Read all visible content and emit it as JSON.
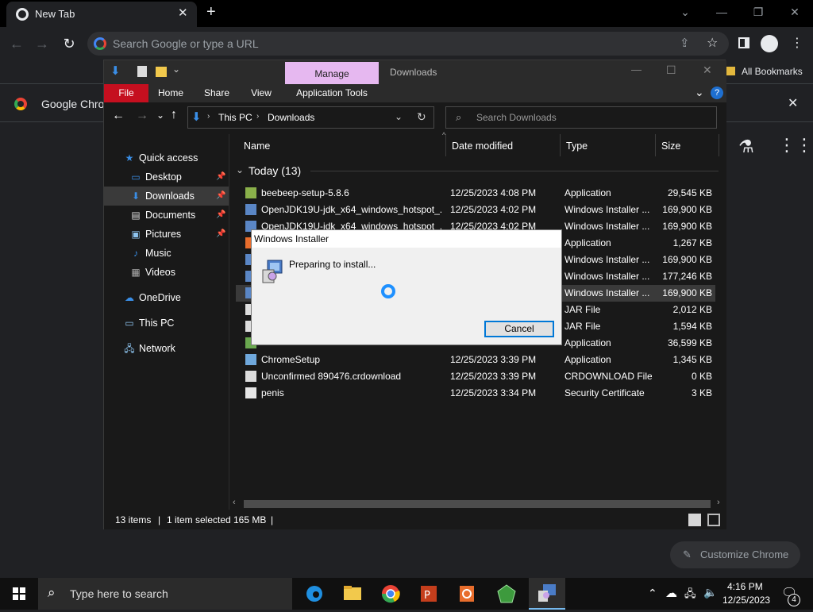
{
  "chrome": {
    "tab_title": "New Tab",
    "omnibox_placeholder": "Search Google or type a URL",
    "bookmarks_label": "All Bookmarks",
    "infobar_text": "Google Chrom",
    "customize_label": "Customize Chrome"
  },
  "explorer": {
    "context_tab": "Manage",
    "window_title": "Downloads",
    "ribbon_tabs": [
      "File",
      "Home",
      "Share",
      "View",
      "Application Tools"
    ],
    "breadcrumb": [
      "This PC",
      "Downloads"
    ],
    "search_placeholder": "Search Downloads",
    "nav": [
      {
        "label": "Quick access",
        "icon": "star-icon",
        "pinned": false
      },
      {
        "label": "Desktop",
        "icon": "desktop-icon",
        "pinned": true
      },
      {
        "label": "Downloads",
        "icon": "download-icon",
        "pinned": true,
        "selected": true
      },
      {
        "label": "Documents",
        "icon": "document-icon",
        "pinned": true
      },
      {
        "label": "Pictures",
        "icon": "pictures-icon",
        "pinned": true
      },
      {
        "label": "Music",
        "icon": "music-icon",
        "pinned": false
      },
      {
        "label": "Videos",
        "icon": "video-icon",
        "pinned": false
      },
      {
        "label": "OneDrive",
        "icon": "cloud-icon",
        "pinned": false
      },
      {
        "label": "This PC",
        "icon": "computer-icon",
        "pinned": false
      },
      {
        "label": "Network",
        "icon": "network-icon",
        "pinned": false
      }
    ],
    "columns": {
      "name": "Name",
      "date": "Date modified",
      "type": "Type",
      "size": "Size"
    },
    "group_label": "Today (13)",
    "files": [
      {
        "name": "beebeep-setup-5.8.6",
        "date": "12/25/2023 4:08 PM",
        "type": "Application",
        "size": "29,545 KB"
      },
      {
        "name": "OpenJDK19U-jdk_x64_windows_hotspot_...",
        "date": "12/25/2023 4:02 PM",
        "type": "Windows Installer ...",
        "size": "169,900 KB"
      },
      {
        "name": "OpenJDK19U-jdk_x64_windows_hotspot_...",
        "date": "12/25/2023 4:02 PM",
        "type": "Windows Installer ...",
        "size": "169,900 KB"
      },
      {
        "name": "",
        "date": "",
        "type": "Application",
        "size": "1,267 KB"
      },
      {
        "name": "",
        "date": "",
        "type": "Windows Installer ...",
        "size": "169,900 KB"
      },
      {
        "name": "",
        "date": "",
        "type": "Windows Installer ...",
        "size": "177,246 KB"
      },
      {
        "name": "",
        "date": "",
        "type": "Windows Installer ...",
        "size": "169,900 KB",
        "selected": true
      },
      {
        "name": "",
        "date": "",
        "type": "JAR File",
        "size": "2,012 KB"
      },
      {
        "name": "",
        "date": "",
        "type": "JAR File",
        "size": "1,594 KB"
      },
      {
        "name": "",
        "date": "",
        "type": "Application",
        "size": "36,599 KB"
      },
      {
        "name": "ChromeSetup",
        "date": "12/25/2023 3:39 PM",
        "type": "Application",
        "size": "1,345 KB"
      },
      {
        "name": "Unconfirmed 890476.crdownload",
        "date": "12/25/2023 3:39 PM",
        "type": "CRDOWNLOAD File",
        "size": "0 KB"
      },
      {
        "name": "penis",
        "date": "12/25/2023 3:34 PM",
        "type": "Security Certificate",
        "size": "3 KB"
      }
    ],
    "status": {
      "count": "13 items",
      "selection": "1 item selected",
      "size": "165 MB"
    }
  },
  "dialog": {
    "title": "Windows Installer",
    "message": "Preparing to install...",
    "cancel_label": "Cancel"
  },
  "taskbar": {
    "search_placeholder": "Type here to search",
    "time": "4:16 PM",
    "date": "12/25/2023",
    "notification_count": "4"
  },
  "colors": {
    "accent": "#0078d7",
    "manage_tab": "#e6b8f0",
    "file_tab": "#c50f1f"
  }
}
